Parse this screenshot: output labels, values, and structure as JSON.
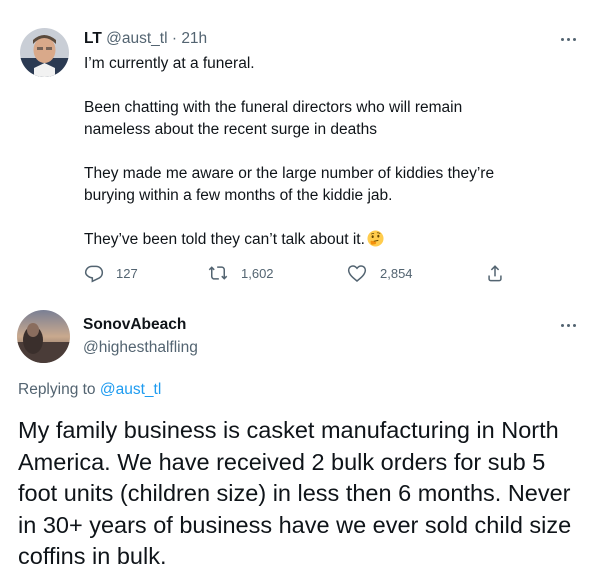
{
  "tweet": {
    "author_name": "LT",
    "author_handle": "@aust_tl",
    "separator": "·",
    "time": "21h",
    "paragraphs": [
      "I’m currently at a funeral.",
      "Been chatting with the funeral directors who will remain\nnameless about the recent surge in deaths",
      "They made me aware or the large number of kiddies they’re\nburying within a few months of the kiddie jab.",
      "They’ve been told they can’t talk about it."
    ],
    "emoji": "thinking-face",
    "replies": "127",
    "retweets": "1,602",
    "likes": "2,854"
  },
  "reply": {
    "author_name": "SonovAbeach",
    "author_handle": "@highesthalfling",
    "replying_prefix": "Replying to",
    "replying_to": "@aust_tl",
    "text": "My family business is casket manufacturing in North America. We have received 2 bulk orders for sub 5 foot units (children size) in less then 6 months. Never in 30+ years of business have we ever sold child size coffins in bulk."
  },
  "colors": {
    "text": "#0f1419",
    "secondary": "#536471",
    "link": "#1d9bf0"
  },
  "icons": [
    "more-icon",
    "reply-icon",
    "retweet-icon",
    "like-icon",
    "share-icon",
    "thinking-face-emoji"
  ]
}
